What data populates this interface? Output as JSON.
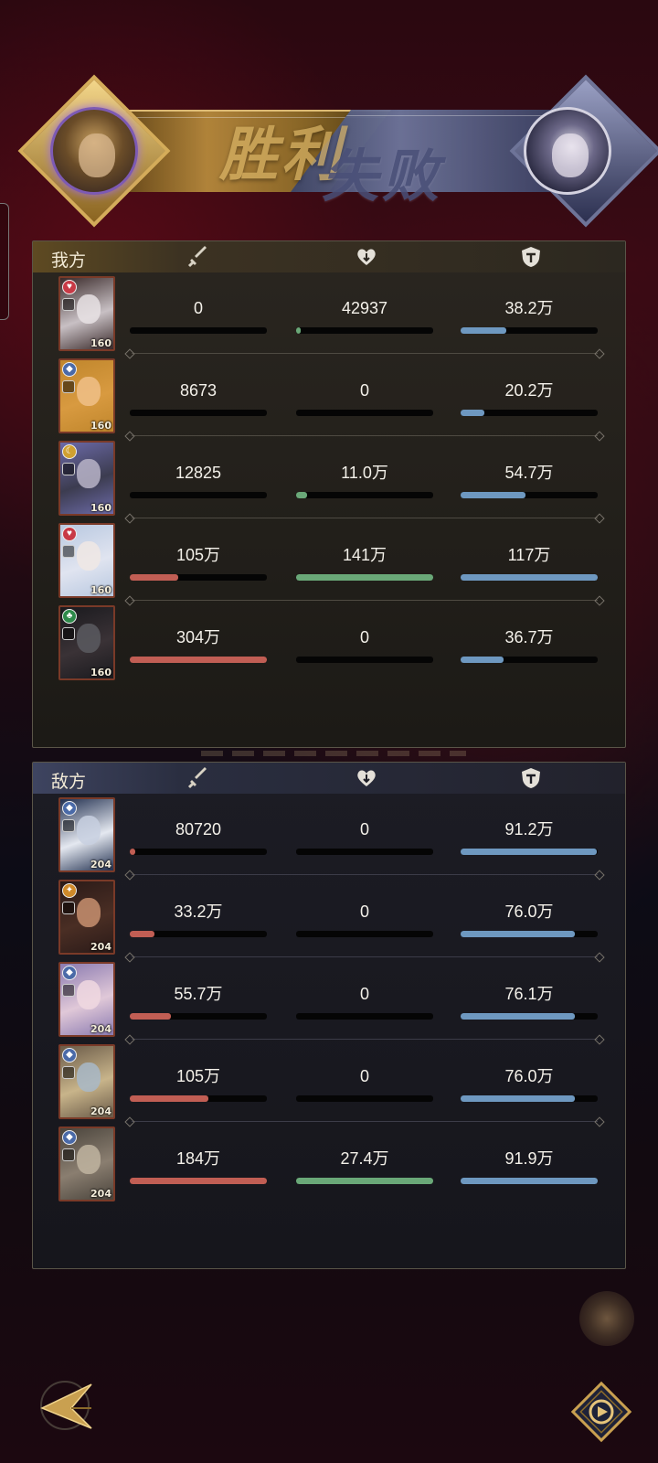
{
  "banner": {
    "result_win": "胜利",
    "result_lose": "失败",
    "left_avatar": "ally-leader-portrait",
    "right_avatar": "enemy-leader-portrait",
    "win_color": "#d9b466",
    "lose_color": "#4a5078"
  },
  "icons": {
    "damage": "sword-icon",
    "healing": "heart-icon",
    "tank": "shield-icon",
    "back": "back-arrow-icon",
    "replay": "replay-icon"
  },
  "colors": {
    "damage_bar": "#c15e54",
    "heal_bar": "#6aa878",
    "tank_bar": "#6e98c0"
  },
  "ally": {
    "label": "我方",
    "heroes": [
      {
        "level": "160",
        "element": "heart",
        "damage": "0",
        "damage_pct": 0,
        "healing": "42937",
        "heal_pct": 3,
        "tank": "38.2万",
        "tank_pct": 33
      },
      {
        "level": "160",
        "element": "shield",
        "damage": "8673",
        "damage_pct": 0,
        "healing": "0",
        "heal_pct": 0,
        "tank": "20.2万",
        "tank_pct": 17
      },
      {
        "level": "160",
        "element": "moon",
        "damage": "12825",
        "damage_pct": 0,
        "healing": "11.0万",
        "heal_pct": 8,
        "tank": "54.7万",
        "tank_pct": 47
      },
      {
        "level": "160",
        "element": "heart",
        "damage": "105万",
        "damage_pct": 35,
        "healing": "141万",
        "heal_pct": 100,
        "tank": "117万",
        "tank_pct": 100
      },
      {
        "level": "160",
        "element": "club",
        "damage": "304万",
        "damage_pct": 100,
        "healing": "0",
        "heal_pct": 0,
        "tank": "36.7万",
        "tank_pct": 31
      }
    ]
  },
  "enemy": {
    "label": "敌方",
    "heroes": [
      {
        "level": "204",
        "element": "shield",
        "damage": "80720",
        "damage_pct": 4,
        "healing": "0",
        "heal_pct": 0,
        "tank": "91.2万",
        "tank_pct": 99
      },
      {
        "level": "204",
        "element": "star",
        "damage": "33.2万",
        "damage_pct": 18,
        "healing": "0",
        "heal_pct": 0,
        "tank": "76.0万",
        "tank_pct": 83
      },
      {
        "level": "204",
        "element": "shield",
        "damage": "55.7万",
        "damage_pct": 30,
        "healing": "0",
        "heal_pct": 0,
        "tank": "76.1万",
        "tank_pct": 83
      },
      {
        "level": "204",
        "element": "shield",
        "damage": "105万",
        "damage_pct": 57,
        "healing": "0",
        "heal_pct": 0,
        "tank": "76.0万",
        "tank_pct": 83
      },
      {
        "level": "204",
        "element": "shield",
        "damage": "184万",
        "damage_pct": 100,
        "healing": "27.4万",
        "heal_pct": 100,
        "tank": "91.9万",
        "tank_pct": 100
      }
    ]
  }
}
